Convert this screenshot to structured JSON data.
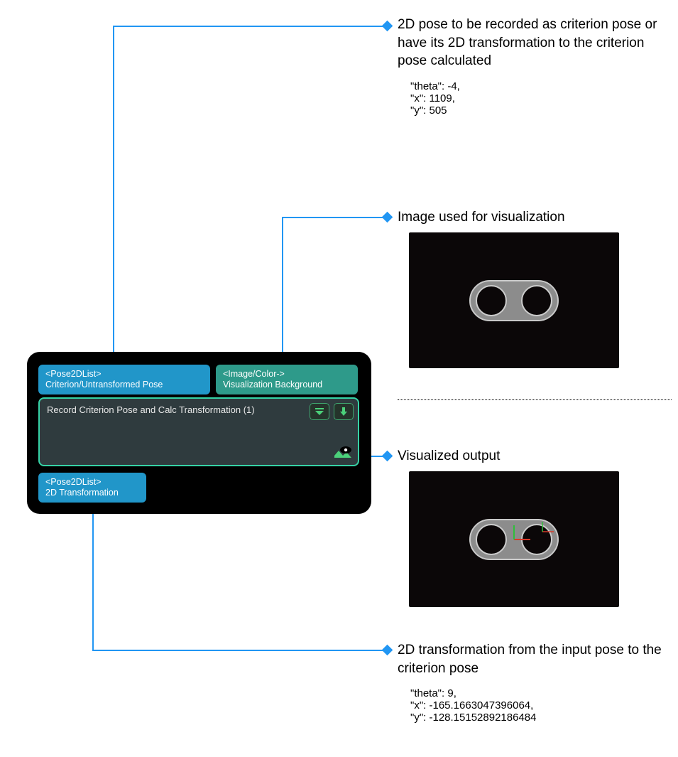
{
  "callouts": {
    "pose_in": {
      "title": "2D pose to be recorded as criterion pose or have its 2D transformation to the criterion pose calculated",
      "data": "\"theta\": -4,\n\"x\": 1109,\n\"y\": 505"
    },
    "image_in": {
      "title": "Image used for visualization"
    },
    "vis_out": {
      "title": "Visualized output"
    },
    "transform_out": {
      "title": "2D transformation from the input pose to the criterion pose",
      "data": "\"theta\": 9,\n\"x\": -165.1663047396064,\n\"y\": -128.15152892186484"
    }
  },
  "node": {
    "in1_type": "<Pose2DList>",
    "in1_label": "Criterion/Untransformed Pose",
    "in2_type": "<Image/Color->",
    "in2_label": "Visualization Background",
    "title": "Record Criterion Pose and Calc Transformation (1)",
    "out_type": "<Pose2DList>",
    "out_label": "2D Transformation"
  }
}
